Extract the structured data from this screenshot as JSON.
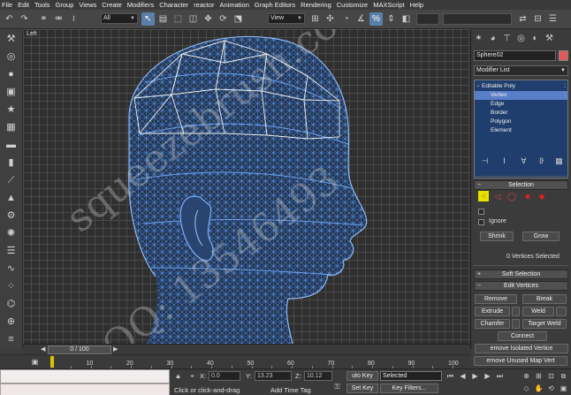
{
  "menu": [
    "File",
    "Edit",
    "Tools",
    "Group",
    "Views",
    "Create",
    "Modifiers",
    "Character",
    "reactor",
    "Animation",
    "Graph Editors",
    "Rendering",
    "Customize",
    "MAXScript",
    "Help"
  ],
  "toolbar": {
    "selection_filter": "All",
    "coord_system": "View"
  },
  "viewport": {
    "label": "Left"
  },
  "command_panel": {
    "object_name": "Sphere02",
    "object_color": "#e05a58",
    "modifier_list": "Modifier List",
    "stack": {
      "base": "Editable Poly",
      "items": [
        "Vertex",
        "Edge",
        "Border",
        "Polygon",
        "Element"
      ],
      "selected": "Vertex"
    },
    "selection": {
      "title": "Selection",
      "ignore_label": "Ignore",
      "shrink": "Shrink",
      "grow": "Grow",
      "status": "0 Vertices Selected"
    },
    "soft_selection": {
      "title": "Soft Selection"
    },
    "edit_vertices": {
      "title": "Edit Vertices",
      "remove": "Remove",
      "break": "Break",
      "extrude": "Extrude",
      "weld": "Weld",
      "chamfer": "Chamfer",
      "target_weld": "Target Weld",
      "connect": "Connect",
      "remove_isolated": "emove Isolated Vertice",
      "remove_unused": "emove Unused Map Vert"
    }
  },
  "time": {
    "slider_label": "0 / 100",
    "ticks": [
      "10",
      "20",
      "30",
      "40",
      "50",
      "60",
      "70",
      "80",
      "90",
      "100"
    ]
  },
  "status": {
    "prompt": "Click or click-and-drag",
    "add_time_tag": "Add Time Tag",
    "x_label": "X:",
    "x_value": "0.0",
    "y_label": "Y:",
    "y_value": "13.23",
    "z_label": "Z:",
    "z_value": "10.12",
    "auto_key": "uto Key",
    "auto_key_mode": "Selected",
    "set_key": "Set Key",
    "key_filters": "Key Filters..."
  },
  "watermark": {
    "line1": "squeezebrush.com",
    "line2": "QQ: 13546493"
  }
}
